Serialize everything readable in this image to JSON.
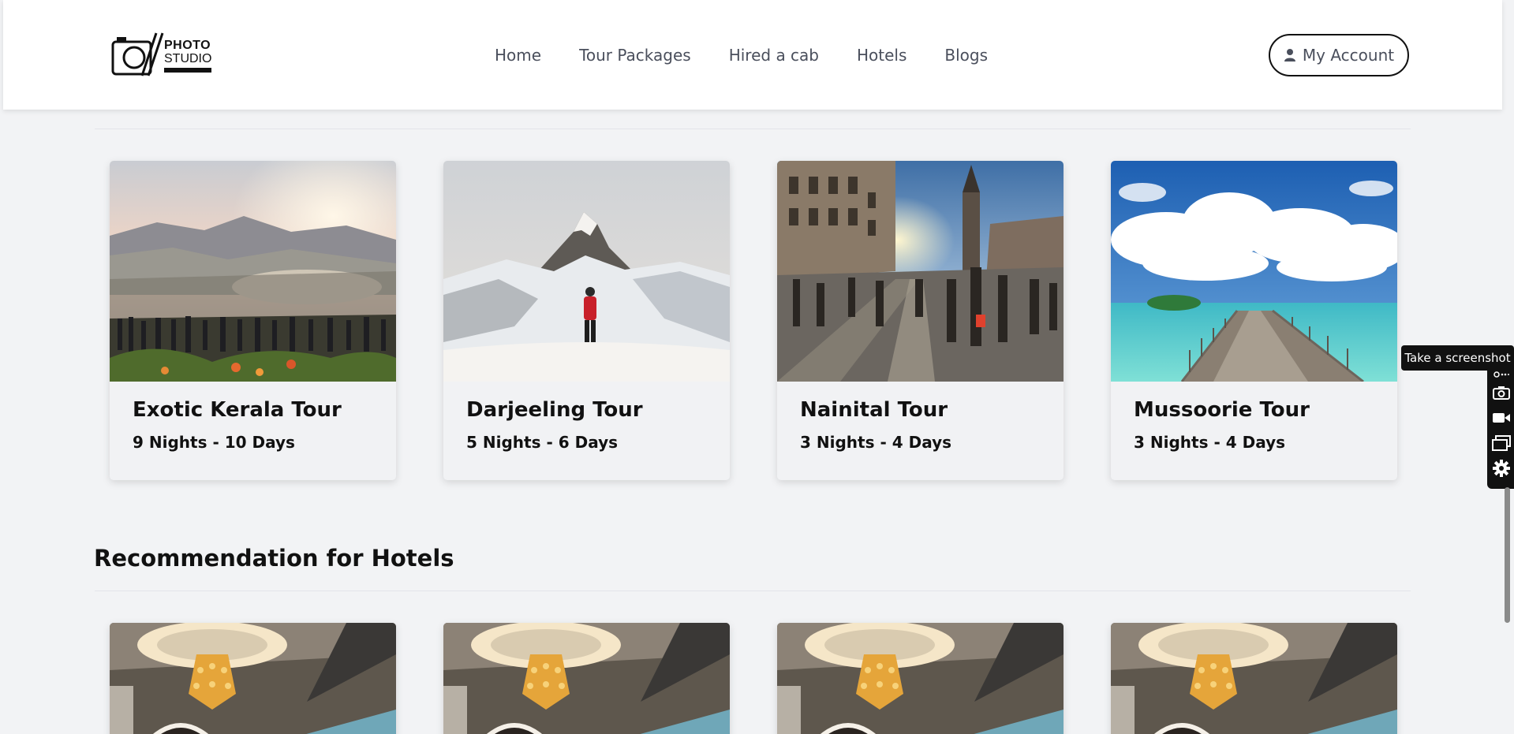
{
  "header": {
    "logo": {
      "line1": "PHOTO",
      "line2": "STUDIO"
    },
    "nav": [
      "Home",
      "Tour Packages",
      "Hired a cab",
      "Hotels",
      "Blogs"
    ],
    "account_label": "My Account"
  },
  "tours": [
    {
      "title": "Exotic Kerala Tour",
      "duration": "9 Nights - 10 Days",
      "image": "sunset-hilltop-crowd"
    },
    {
      "title": "Darjeeling Tour",
      "duration": "5 Nights - 6 Days",
      "image": "snowy-mountain-hiker"
    },
    {
      "title": "Nainital Tour",
      "duration": "3 Nights - 4 Days",
      "image": "busy-town-square"
    },
    {
      "title": "Mussoorie Tour",
      "duration": "3 Nights - 4 Days",
      "image": "ocean-pier"
    }
  ],
  "hotels_section": {
    "title": "Recommendation for Hotels",
    "cards": [
      {
        "image": "chandelier-lobby"
      },
      {
        "image": "chandelier-lobby"
      },
      {
        "image": "chandelier-lobby"
      },
      {
        "image": "chandelier-lobby"
      }
    ]
  },
  "screenshot_tool": {
    "tooltip": "Take a screenshot",
    "tools": [
      "link-icon",
      "camera-icon",
      "video-icon",
      "window-icon",
      "gear-icon"
    ]
  },
  "colors": {
    "background": "#f2f3f5",
    "header": "#ffffff",
    "nav_text": "#4a4f5c",
    "heading": "#111111"
  }
}
